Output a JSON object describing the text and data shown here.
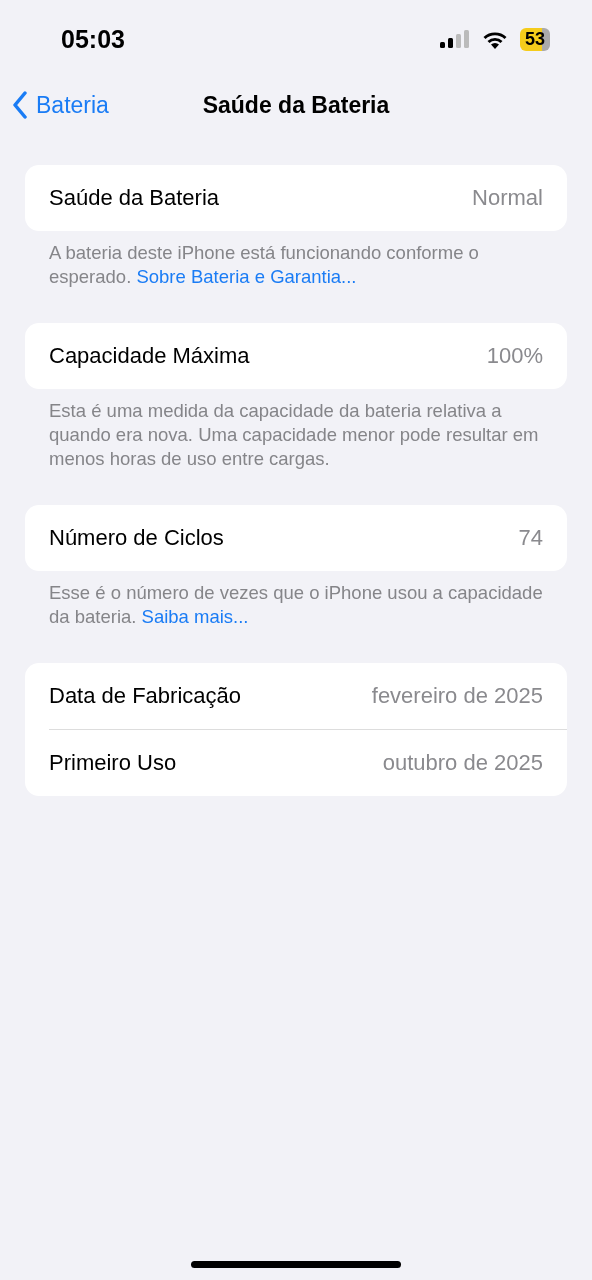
{
  "status_bar": {
    "time": "05:03",
    "battery": "53"
  },
  "nav": {
    "back": "Bateria",
    "title": "Saúde da Bateria"
  },
  "sections": [
    {
      "rows": [
        {
          "label": "Saúde da Bateria",
          "value": "Normal"
        }
      ],
      "footer": {
        "text": "A bateria deste iPhone está funcionando conforme o esperado.",
        "link": "Sobre Bateria e Garantia..."
      }
    },
    {
      "rows": [
        {
          "label": "Capacidade Máxima",
          "value": "100%"
        }
      ],
      "footer": {
        "text": "Esta é uma medida da capacidade da bateria relativa a quando era nova. Uma capacidade menor pode resultar em menos horas de uso entre cargas."
      }
    },
    {
      "rows": [
        {
          "label": "Número de Ciclos",
          "value": "74"
        }
      ],
      "footer": {
        "text": "Esse é o número de vezes que o iPhone usou a capacidade da bateria.",
        "link": "Saiba mais..."
      }
    },
    {
      "rows": [
        {
          "label": "Data de Fabricação",
          "value": "fevereiro de 2025"
        },
        {
          "label": "Primeiro Uso",
          "value": "outubro de 2025"
        }
      ]
    }
  ]
}
